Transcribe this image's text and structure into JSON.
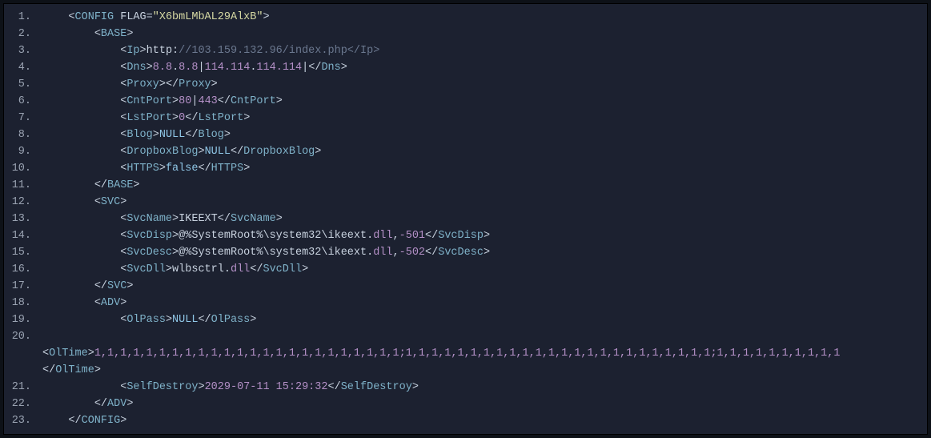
{
  "lines": [
    {
      "n": "1.",
      "indent": 1,
      "segs": [
        [
          "punct",
          "<"
        ],
        [
          "tag",
          "CONFIG"
        ],
        [
          "plain",
          " "
        ],
        [
          "attr",
          "FLAG"
        ],
        [
          "punct",
          "="
        ],
        [
          "str",
          "\"X6bmLMbAL29AlxB\""
        ],
        [
          "punct",
          ">"
        ]
      ]
    },
    {
      "n": "2.",
      "indent": 2,
      "segs": [
        [
          "punct",
          "<"
        ],
        [
          "tag",
          "BASE"
        ],
        [
          "punct",
          ">"
        ]
      ]
    },
    {
      "n": "3.",
      "indent": 3,
      "segs": [
        [
          "punct",
          "<"
        ],
        [
          "tag",
          "Ip"
        ],
        [
          "punct",
          ">"
        ],
        [
          "plain",
          "http:"
        ],
        [
          "url",
          "//103.159.132.96/index.php</Ip>"
        ]
      ]
    },
    {
      "n": "4.",
      "indent": 3,
      "segs": [
        [
          "punct",
          "<"
        ],
        [
          "tag",
          "Dns"
        ],
        [
          "punct",
          ">"
        ],
        [
          "num",
          "8.8"
        ],
        [
          "plain",
          "."
        ],
        [
          "num",
          "8.8"
        ],
        [
          "plain",
          "|"
        ],
        [
          "num",
          "114.114"
        ],
        [
          "plain",
          "."
        ],
        [
          "num",
          "114.114"
        ],
        [
          "plain",
          "|"
        ],
        [
          "punct",
          "</"
        ],
        [
          "tag",
          "Dns"
        ],
        [
          "punct",
          ">"
        ]
      ]
    },
    {
      "n": "5.",
      "indent": 3,
      "segs": [
        [
          "punct",
          "<"
        ],
        [
          "tag",
          "Proxy"
        ],
        [
          "punct",
          "></"
        ],
        [
          "tag",
          "Proxy"
        ],
        [
          "punct",
          ">"
        ]
      ]
    },
    {
      "n": "6.",
      "indent": 3,
      "segs": [
        [
          "punct",
          "<"
        ],
        [
          "tag",
          "CntPort"
        ],
        [
          "punct",
          ">"
        ],
        [
          "num",
          "80"
        ],
        [
          "plain",
          "|"
        ],
        [
          "num",
          "443"
        ],
        [
          "punct",
          "</"
        ],
        [
          "tag",
          "CntPort"
        ],
        [
          "punct",
          ">"
        ]
      ]
    },
    {
      "n": "7.",
      "indent": 3,
      "segs": [
        [
          "punct",
          "<"
        ],
        [
          "tag",
          "LstPort"
        ],
        [
          "punct",
          ">"
        ],
        [
          "num",
          "0"
        ],
        [
          "punct",
          "</"
        ],
        [
          "tag",
          "LstPort"
        ],
        [
          "punct",
          ">"
        ]
      ]
    },
    {
      "n": "8.",
      "indent": 3,
      "segs": [
        [
          "punct",
          "<"
        ],
        [
          "tag",
          "Blog"
        ],
        [
          "punct",
          ">"
        ],
        [
          "kw",
          "NULL"
        ],
        [
          "punct",
          "</"
        ],
        [
          "tag",
          "Blog"
        ],
        [
          "punct",
          ">"
        ]
      ]
    },
    {
      "n": "9.",
      "indent": 3,
      "segs": [
        [
          "punct",
          "<"
        ],
        [
          "tag",
          "DropboxBlog"
        ],
        [
          "punct",
          ">"
        ],
        [
          "kw",
          "NULL"
        ],
        [
          "punct",
          "</"
        ],
        [
          "tag",
          "DropboxBlog"
        ],
        [
          "punct",
          ">"
        ]
      ]
    },
    {
      "n": "10.",
      "indent": 3,
      "segs": [
        [
          "punct",
          "<"
        ],
        [
          "tag",
          "HTTPS"
        ],
        [
          "punct",
          ">"
        ],
        [
          "kw",
          "false"
        ],
        [
          "punct",
          "</"
        ],
        [
          "tag",
          "HTTPS"
        ],
        [
          "punct",
          ">"
        ]
      ]
    },
    {
      "n": "11.",
      "indent": 2,
      "segs": [
        [
          "punct",
          "</"
        ],
        [
          "tag",
          "BASE"
        ],
        [
          "punct",
          ">"
        ]
      ]
    },
    {
      "n": "12.",
      "indent": 2,
      "segs": [
        [
          "punct",
          "<"
        ],
        [
          "tag",
          "SVC"
        ],
        [
          "punct",
          ">"
        ]
      ]
    },
    {
      "n": "13.",
      "indent": 3,
      "segs": [
        [
          "punct",
          "<"
        ],
        [
          "tag",
          "SvcName"
        ],
        [
          "punct",
          ">"
        ],
        [
          "plain",
          "IKEEXT"
        ],
        [
          "punct",
          "</"
        ],
        [
          "tag",
          "SvcName"
        ],
        [
          "punct",
          ">"
        ]
      ]
    },
    {
      "n": "14.",
      "indent": 3,
      "segs": [
        [
          "punct",
          "<"
        ],
        [
          "tag",
          "SvcDisp"
        ],
        [
          "punct",
          ">"
        ],
        [
          "plain",
          "@%SystemRoot%\\system32\\ikeext."
        ],
        [
          "dll",
          "dll"
        ],
        [
          "plain",
          ","
        ],
        [
          "num",
          "-501"
        ],
        [
          "punct",
          "</"
        ],
        [
          "tag",
          "SvcDisp"
        ],
        [
          "punct",
          ">"
        ]
      ]
    },
    {
      "n": "15.",
      "indent": 3,
      "segs": [
        [
          "punct",
          "<"
        ],
        [
          "tag",
          "SvcDesc"
        ],
        [
          "punct",
          ">"
        ],
        [
          "plain",
          "@%SystemRoot%\\system32\\ikeext."
        ],
        [
          "dll",
          "dll"
        ],
        [
          "plain",
          ","
        ],
        [
          "num",
          "-502"
        ],
        [
          "punct",
          "</"
        ],
        [
          "tag",
          "SvcDesc"
        ],
        [
          "punct",
          ">"
        ]
      ]
    },
    {
      "n": "16.",
      "indent": 3,
      "segs": [
        [
          "punct",
          "<"
        ],
        [
          "tag",
          "SvcDll"
        ],
        [
          "punct",
          ">"
        ],
        [
          "plain",
          "wlbsctrl."
        ],
        [
          "dll",
          "dll"
        ],
        [
          "punct",
          "</"
        ],
        [
          "tag",
          "SvcDll"
        ],
        [
          "punct",
          ">"
        ]
      ]
    },
    {
      "n": "17.",
      "indent": 2,
      "segs": [
        [
          "punct",
          "</"
        ],
        [
          "tag",
          "SVC"
        ],
        [
          "punct",
          ">"
        ]
      ]
    },
    {
      "n": "18.",
      "indent": 2,
      "segs": [
        [
          "punct",
          "<"
        ],
        [
          "tag",
          "ADV"
        ],
        [
          "punct",
          ">"
        ]
      ]
    },
    {
      "n": "19.",
      "indent": 3,
      "segs": [
        [
          "punct",
          "<"
        ],
        [
          "tag",
          "OlPass"
        ],
        [
          "punct",
          ">"
        ],
        [
          "kw",
          "NULL"
        ],
        [
          "punct",
          "</"
        ],
        [
          "tag",
          "OlPass"
        ],
        [
          "punct",
          ">"
        ]
      ]
    },
    {
      "n": "20.",
      "indent": 0,
      "segs": []
    }
  ],
  "oltime_open": [
    [
      "punct",
      "<"
    ],
    [
      "tag",
      "OlTime"
    ],
    [
      "punct",
      ">"
    ]
  ],
  "oltime_values": "1,1,1,1,1,1,1,1,1,1,1,1,1,1,1,1,1,1,1,1,1,1,1,1;1,1,1,1,1,1,1,1,1,1,1,1,1,1,1,1,1,1,1,1,1,1,1,1;1,1,1,1,1,1,1,1,1,1",
  "oltime_close": [
    [
      "punct",
      "</"
    ],
    [
      "tag",
      "OlTime"
    ],
    [
      "punct",
      ">"
    ]
  ],
  "lines_after": [
    {
      "n": "21.",
      "indent": 3,
      "segs": [
        [
          "punct",
          "<"
        ],
        [
          "tag",
          "SelfDestroy"
        ],
        [
          "punct",
          ">"
        ],
        [
          "date",
          "2029-07-11 15:29:32"
        ],
        [
          "punct",
          "</"
        ],
        [
          "tag",
          "SelfDestroy"
        ],
        [
          "punct",
          ">"
        ]
      ]
    },
    {
      "n": "22.",
      "indent": 2,
      "segs": [
        [
          "punct",
          "</"
        ],
        [
          "tag",
          "ADV"
        ],
        [
          "punct",
          ">"
        ]
      ]
    },
    {
      "n": "23.",
      "indent": 1,
      "segs": [
        [
          "punct",
          "</"
        ],
        [
          "tag",
          "CONFIG"
        ],
        [
          "punct",
          ">"
        ]
      ]
    }
  ]
}
